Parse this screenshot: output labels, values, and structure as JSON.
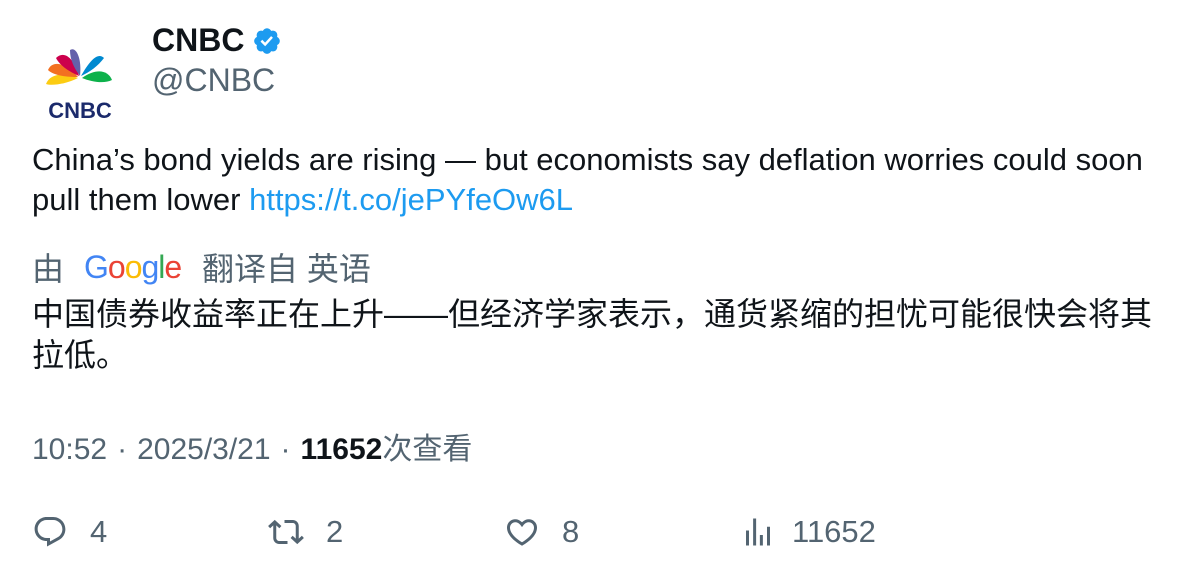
{
  "author": {
    "name": "CNBC",
    "handle": "@CNBC",
    "avatar_text": "CNBC",
    "verified": true
  },
  "tweet": {
    "text": "China’s bond yields are rising — but economists say deflation worries could soon pull them lower ",
    "link": "https://t.co/jePYfeOw6L"
  },
  "translation": {
    "prefix": "由",
    "provider": "Google",
    "suffix": "翻译自 英语",
    "text": "中国债券收益率正在上升——但经济学家表示，通货紧缩的担忧可能很快会将其拉低。"
  },
  "meta": {
    "time": "10:52",
    "separator": "·",
    "date": "2025/3/21",
    "views_count": "11652",
    "views_label": "次查看"
  },
  "actions": {
    "replies": "4",
    "retweets": "2",
    "likes": "8",
    "views": "11652"
  },
  "colors": {
    "link": "#1d9bf0",
    "secondary_text": "#536471",
    "primary_text": "#0f1419",
    "verified": "#1d9bf0"
  }
}
